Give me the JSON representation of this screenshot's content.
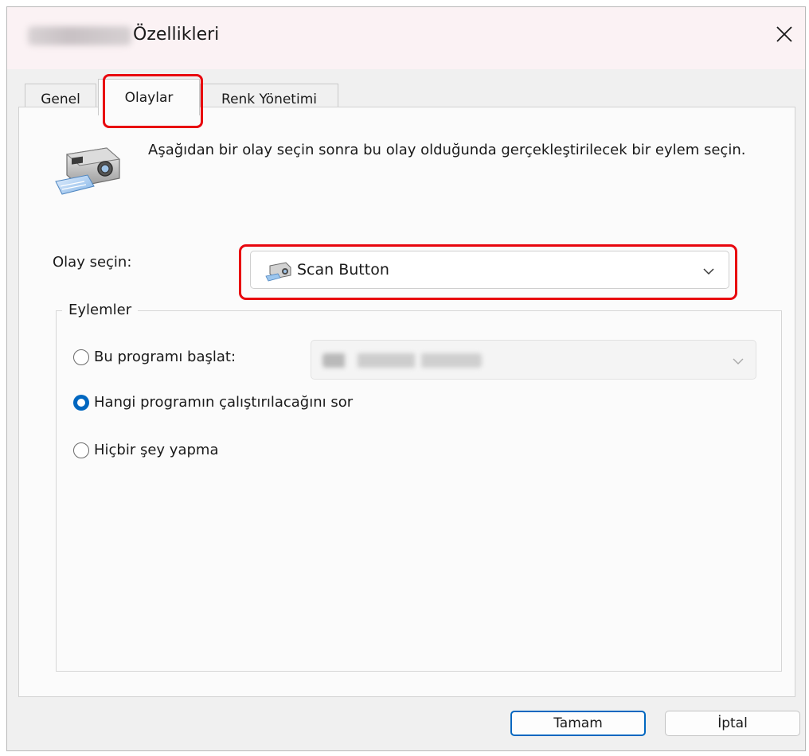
{
  "window": {
    "title": "Özellikleri",
    "close_icon": "close-icon"
  },
  "tabs": [
    {
      "label": "Genel",
      "active": false
    },
    {
      "label": "Olaylar",
      "active": true
    },
    {
      "label": "Renk Yönetimi",
      "active": false
    }
  ],
  "events": {
    "description": "Aşağıdan bir olay seçin sonra bu olay olduğunda gerçekleştirilecek bir eylem seçin.",
    "icon": "scanner-icon",
    "select_label": "Olay seçin:",
    "selected_event": "Scan Button",
    "selected_event_icon": "scanner-icon"
  },
  "actions": {
    "legend": "Eylemler",
    "options": [
      {
        "label": "Bu programı başlat:",
        "checked": false
      },
      {
        "label": "Hangi programın çalıştırılacağını sor",
        "checked": true
      },
      {
        "label": "Hiçbir şey yapma",
        "checked": false
      }
    ]
  },
  "buttons": {
    "ok": "Tamam",
    "cancel": "İptal"
  },
  "colors": {
    "accent": "#0067c0",
    "highlight": "#e8060e",
    "titlebar": "#fbf2f4"
  }
}
